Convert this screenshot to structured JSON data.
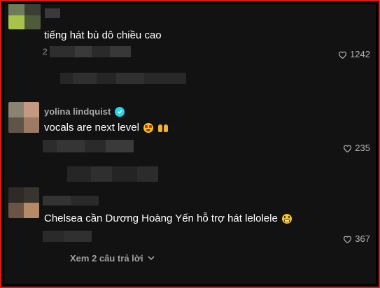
{
  "comments": [
    {
      "username": "",
      "text": "tiếng hát bù dô chiều cao",
      "likes": "1242",
      "verified": false,
      "date_prefix": "2"
    },
    {
      "username": "yolina lindquist",
      "text": "vocals are next level",
      "likes": "235",
      "verified": true
    },
    {
      "username": "",
      "text": "Chelsea cần Dương Hoàng Yến hỗ trợ hát lelolele",
      "likes": "367",
      "verified": false
    }
  ],
  "view_replies_label": "Xem 2 câu trả lời",
  "icons": {
    "like": "heart-outline-icon",
    "verified": "verified-badge-icon",
    "expand": "chevron-down-icon",
    "emoji_1": "star-struck-emoji",
    "emoji_2": "raising-hands-emoji",
    "emoji_3": "grinning-emoji"
  },
  "colors": {
    "background": "#121212",
    "text": "#ffffff",
    "secondary": "#a9a9a9",
    "verified": "#20d5ec",
    "frame": "#e01818"
  }
}
